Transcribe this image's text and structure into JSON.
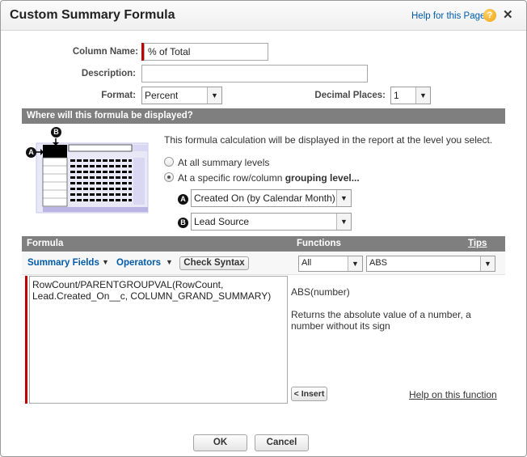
{
  "dialog": {
    "title": "Custom Summary Formula",
    "help_link": "Help for this Page",
    "help_icon_glyph": "?",
    "close_glyph": "✕"
  },
  "fields": {
    "column_name_label": "Column Name:",
    "column_name_value": "% of Total",
    "description_label": "Description:",
    "description_value": "",
    "format_label": "Format:",
    "format_value": "Percent",
    "decimal_label": "Decimal Places:",
    "decimal_value": "1"
  },
  "display_section": {
    "title": "Where will this formula be displayed?",
    "info": "This formula calculation will be displayed in the report at the level you select.",
    "option_all": "At all summary levels",
    "option_specific_prefix": "At a specific row/column ",
    "option_specific_bold": "grouping level...",
    "selected_option": "specific",
    "badge_a": "A",
    "badge_b": "B",
    "grouping_a_value": "Created On (by Calendar Month)",
    "grouping_b_value": "Lead Source"
  },
  "formula_section": {
    "formula_header": "Formula",
    "functions_header": "Functions",
    "tips_link": "Tips",
    "summary_fields_label": "Summary Fields",
    "operators_label": "Operators",
    "check_syntax_button": "Check Syntax",
    "functions_category": "All",
    "function_selected": "ABS",
    "formula_text_line1": "RowCount/PARENTGROUPVAL(RowCount,",
    "formula_text_line2": "Lead.Created_On__c, COLUMN_GRAND_SUMMARY)",
    "function_signature": "ABS(number)",
    "function_description": "Returns the absolute value of a number, a number without its sign",
    "insert_button": "< Insert",
    "help_function_link": "Help on this function"
  },
  "footer": {
    "ok_button": "OK",
    "cancel_button": "Cancel"
  },
  "colors": {
    "band": "#7f7f7f",
    "required": "#c00000",
    "link": "#015ba7",
    "diagram_grid": "#c9c7ea"
  }
}
